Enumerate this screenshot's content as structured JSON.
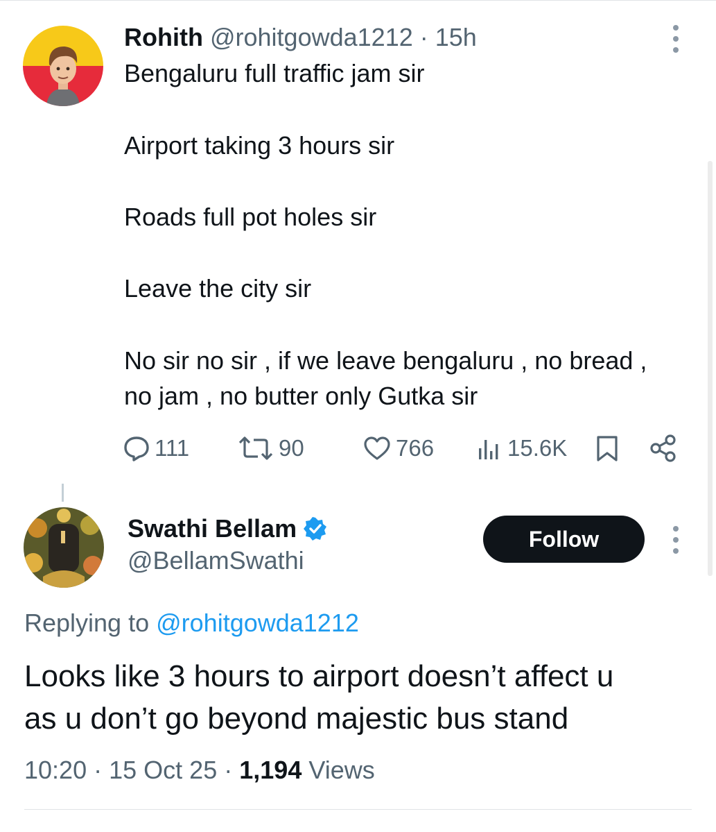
{
  "original_tweet": {
    "author_name": "Rohith",
    "handle": "@rohitgowda1212",
    "separator": "·",
    "time": "15h",
    "lines": [
      "Bengaluru full traffic jam sir",
      "Airport taking 3 hours sir",
      "Roads full pot holes sir",
      "Leave the city sir",
      "No sir no sir , if we leave bengaluru , no bread ,",
      "no jam , no butter only Gutka sir"
    ],
    "actions": {
      "replies": "111",
      "reposts": "90",
      "likes": "766",
      "views": "15.6K"
    },
    "icons": [
      "reply-icon",
      "repost-icon",
      "like-icon",
      "views-icon",
      "bookmark-icon",
      "share-icon",
      "more-icon"
    ]
  },
  "reply": {
    "author_name": "Swathi Bellam",
    "handle": "@BellamSwathi",
    "verified": true,
    "verified_color": "#1d9bf0",
    "follow_label": "Follow",
    "replying_prefix": "Replying to",
    "replying_handle": "@rohitgowda1212",
    "lines": [
      "Looks like 3 hours to airport doesn’t affect u",
      "as u don’t go beyond majestic bus stand"
    ],
    "time": "10:20",
    "date": "15 Oct 25",
    "separator": "·",
    "views_count": "1,194",
    "views_label": "Views"
  },
  "colors": {
    "text": "#0f1419",
    "secondary": "#536471",
    "link": "#1d9bf0",
    "follow_bg": "#0f1419"
  }
}
